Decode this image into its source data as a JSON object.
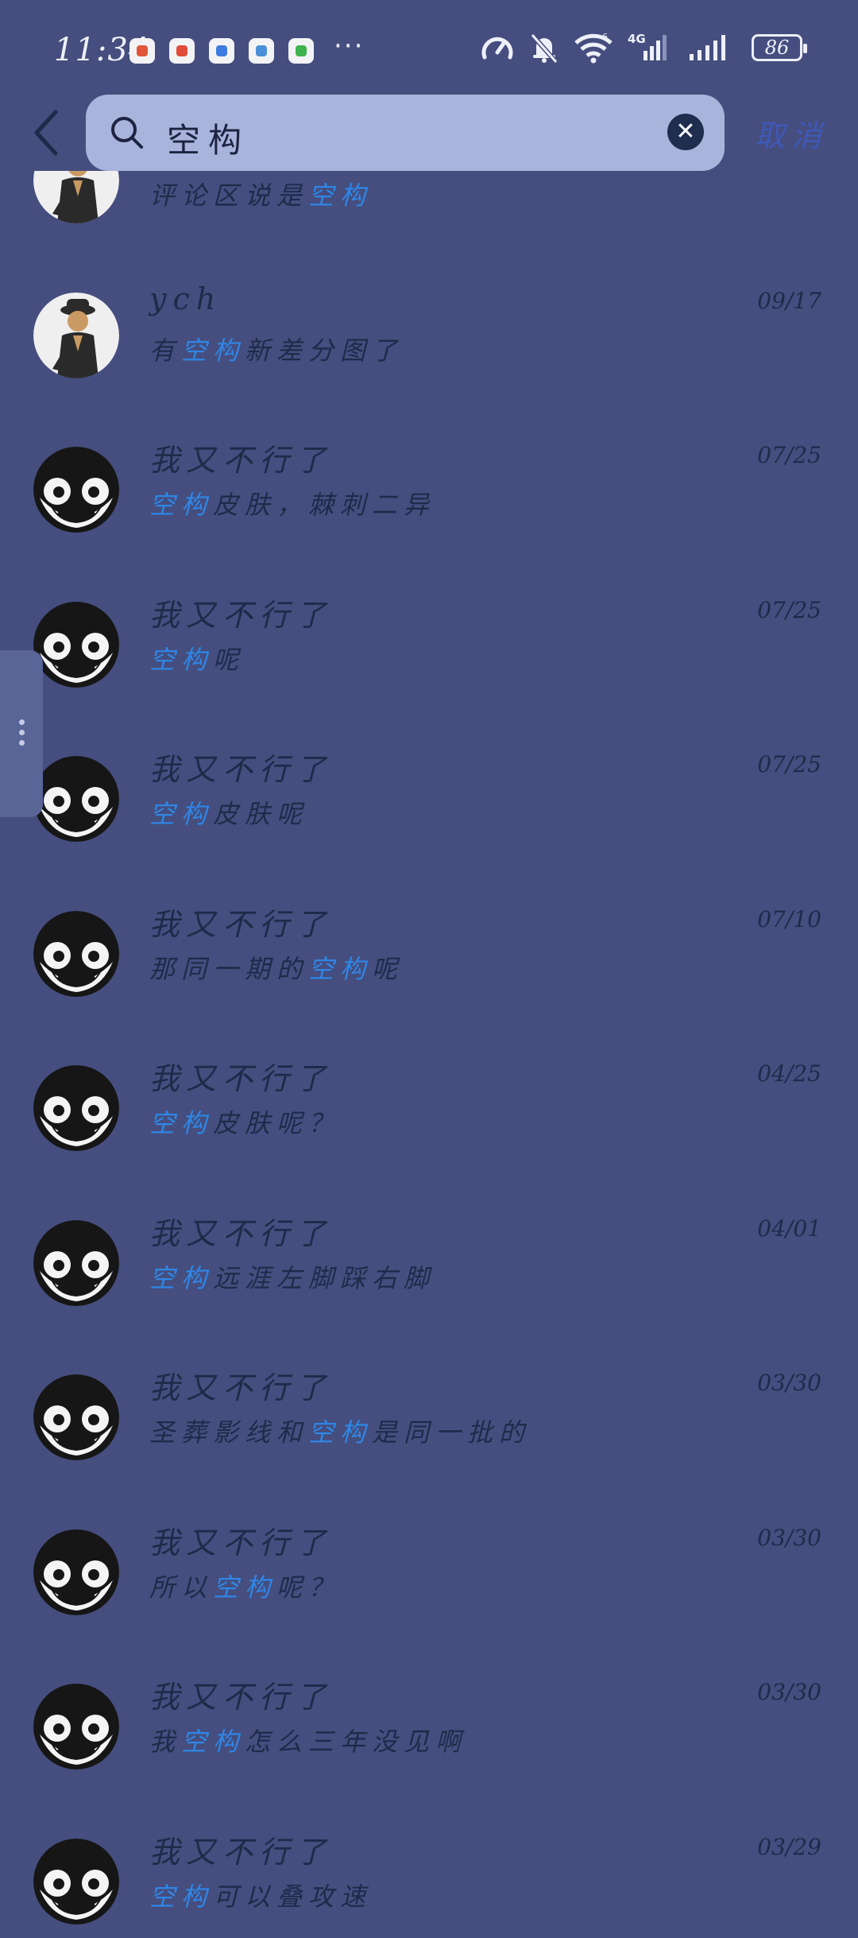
{
  "status_bar": {
    "time": "11:34",
    "app_icons": [
      {
        "name": "app-icon-red",
        "color": "#e0553b"
      },
      {
        "name": "app-icon-red-2",
        "color": "#e14b3a"
      },
      {
        "name": "app-icon-blue",
        "color": "#3d7be0"
      },
      {
        "name": "app-icon-blue-2",
        "color": "#4b8fd8"
      },
      {
        "name": "app-icon-green",
        "color": "#3fb34f"
      }
    ],
    "more": "···",
    "battery": "86"
  },
  "search": {
    "query": "空构",
    "cancel_label": "取消"
  },
  "results": [
    {
      "name": "",
      "date": "",
      "avatar": "cowboy",
      "msg": [
        {
          "t": "评论区说是",
          "h": false
        },
        {
          "t": "空构",
          "h": true
        }
      ]
    },
    {
      "name": "ych",
      "date": "09/17",
      "avatar": "cowboy",
      "msg": [
        {
          "t": "有",
          "h": false
        },
        {
          "t": "空构",
          "h": true
        },
        {
          "t": "新差分图了",
          "h": false
        }
      ]
    },
    {
      "name": "我又不行了",
      "date": "07/25",
      "avatar": "monster",
      "msg": [
        {
          "t": "空构",
          "h": true
        },
        {
          "t": "皮肤，棘刺二异",
          "h": false
        }
      ]
    },
    {
      "name": "我又不行了",
      "date": "07/25",
      "avatar": "monster",
      "msg": [
        {
          "t": "空构",
          "h": true
        },
        {
          "t": "呢",
          "h": false
        }
      ]
    },
    {
      "name": "我又不行了",
      "date": "07/25",
      "avatar": "monster",
      "msg": [
        {
          "t": "空构",
          "h": true
        },
        {
          "t": "皮肤呢",
          "h": false
        }
      ]
    },
    {
      "name": "我又不行了",
      "date": "07/10",
      "avatar": "monster",
      "msg": [
        {
          "t": "那同一期的",
          "h": false
        },
        {
          "t": "空构",
          "h": true
        },
        {
          "t": "呢",
          "h": false
        }
      ]
    },
    {
      "name": "我又不行了",
      "date": "04/25",
      "avatar": "monster",
      "msg": [
        {
          "t": "空构",
          "h": true
        },
        {
          "t": "皮肤呢？",
          "h": false
        }
      ]
    },
    {
      "name": "我又不行了",
      "date": "04/01",
      "avatar": "monster",
      "msg": [
        {
          "t": "空构",
          "h": true
        },
        {
          "t": "远涯左脚踩右脚",
          "h": false
        }
      ]
    },
    {
      "name": "我又不行了",
      "date": "03/30",
      "avatar": "monster",
      "msg": [
        {
          "t": "圣葬影线和",
          "h": false
        },
        {
          "t": "空构",
          "h": true
        },
        {
          "t": "是同一批的",
          "h": false
        }
      ]
    },
    {
      "name": "我又不行了",
      "date": "03/30",
      "avatar": "monster",
      "msg": [
        {
          "t": "所以",
          "h": false
        },
        {
          "t": "空构",
          "h": true
        },
        {
          "t": "呢？",
          "h": false
        }
      ]
    },
    {
      "name": "我又不行了",
      "date": "03/30",
      "avatar": "monster",
      "msg": [
        {
          "t": "我",
          "h": false
        },
        {
          "t": "空构",
          "h": true
        },
        {
          "t": "怎么三年没见啊",
          "h": false
        }
      ]
    },
    {
      "name": "我又不行了",
      "date": "03/29",
      "avatar": "monster",
      "msg": [
        {
          "t": "空构",
          "h": true
        },
        {
          "t": "可以叠攻速",
          "h": false
        }
      ]
    }
  ]
}
